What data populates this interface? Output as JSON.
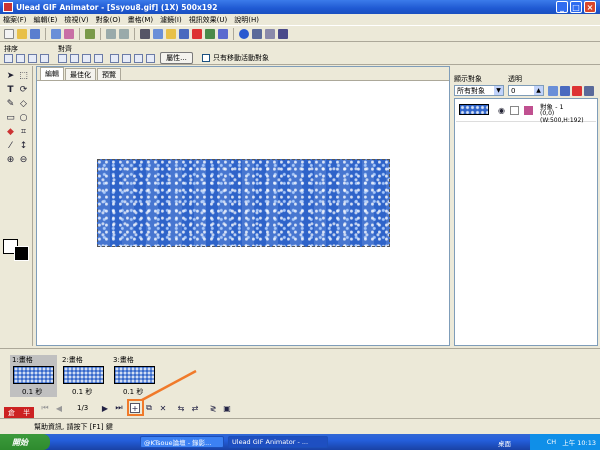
{
  "window": {
    "title": "Ulead GIF Animator - [Ssyou8.gif] (1X) 500x192",
    "minimize": "_",
    "maximize": "□",
    "close": "×"
  },
  "menu": [
    "檔案(F)",
    "編輯(E)",
    "檢視(V)",
    "對象(O)",
    "畫格(M)",
    "濾鏡(I)",
    "視訊效果(U)",
    "說明(H)"
  ],
  "toolbar2": {
    "order_label": "排序",
    "align_label": "對齊",
    "properties_button": "屬性...",
    "only_moving_label": "只有移動活動對象"
  },
  "canvas_tabs": [
    "編輯",
    "最佳化",
    "預覽"
  ],
  "objects_panel": {
    "display_label": "顯示對象",
    "display_value": "所有對象",
    "opacity_label": "透明",
    "opacity_value": "0",
    "object": {
      "name": "對象 - 1",
      "bounds": "(0,0)(W:500,H:192)"
    }
  },
  "frames": [
    {
      "label": "1:畫格",
      "delay": "0.1 秒"
    },
    {
      "label": "2:畫格",
      "delay": "0.1 秒"
    },
    {
      "label": "3:畫格",
      "delay": "0.1 秒"
    }
  ],
  "frame_counter": "1/3",
  "status": "幫助資訊, 請按下 [F1] 鍵",
  "ime": {
    "a": "倉",
    "b": "半"
  },
  "taskbar": {
    "start": "開始",
    "task1": "@KTsoue論壇 - 錄影...",
    "task2": "Ulead GIF Animator - ...",
    "tray_desktop": "桌面",
    "tray_lang": "CH",
    "clock": "上午 10:13"
  }
}
